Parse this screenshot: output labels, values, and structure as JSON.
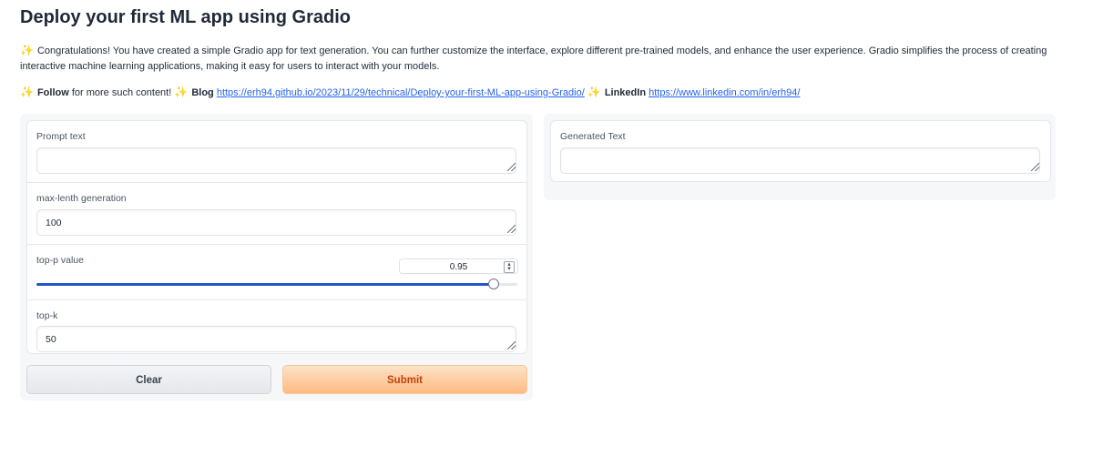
{
  "header": {
    "title": "Deploy your first ML app using Gradio"
  },
  "intro": {
    "text": "Congratulations! You have created a simple Gradio app for text generation. You can further customize the interface, explore different pre-trained models, and enhance the user experience. Gradio simplifies the process of creating interactive machine learning applications, making it easy for users to interact with your models."
  },
  "links_line": {
    "follow_label": "Follow",
    "follow_text": "for more such content!",
    "blog_label": "Blog",
    "blog_url": "https://erh94.github.io/2023/11/29/technical/Deploy-your-first-ML-app-using-Gradio/",
    "linkedin_label": "LinkedIn",
    "linkedin_url": "https://www.linkedin.com/in/erh94/"
  },
  "inputs": {
    "prompt": {
      "label": "Prompt text",
      "value": ""
    },
    "max_length": {
      "label": "max-lenth generation",
      "value": "100"
    },
    "top_p": {
      "label": "top-p value",
      "value": "0.95",
      "slider_fraction": 0.95
    },
    "top_k": {
      "label": "top-k",
      "value": "50"
    }
  },
  "outputs": {
    "generated": {
      "label": "Generated Text",
      "value": ""
    }
  },
  "buttons": {
    "clear": "Clear",
    "submit": "Submit"
  },
  "icons": {
    "sparkle": "sparkle-icon",
    "resize": "resize-grip-icon",
    "spinner": "number-spinner-icon"
  },
  "colors": {
    "accent": "#2256c4",
    "submit_bg": "#fdba80",
    "submit_text": "#c2410c",
    "link": "#2563eb"
  }
}
